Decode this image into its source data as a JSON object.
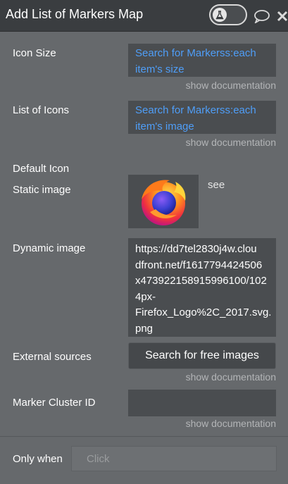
{
  "header": {
    "title": "Add List of Markers Map",
    "toggle_icon": "flask-icon",
    "chat_icon": "comment-icon",
    "close_icon": "close-icon"
  },
  "fields": {
    "icon_size": {
      "label": "Icon Size",
      "value_line1": "Search for Markerss:each",
      "value_line2": "item's size",
      "doc": "show documentation"
    },
    "list_of_icons": {
      "label": "List of Icons",
      "value_line1": "Search for Markerss:each",
      "value_line2": "item's image",
      "doc": "show documentation"
    },
    "default_icon": {
      "label": "Default Icon",
      "static_label": "Static image",
      "see_link": "see",
      "dynamic_label": "Dynamic image",
      "dynamic_lines": [
        "https://dd7tel2830j4w.clou",
        "dfront.net/f1617794424506",
        "x473922158915996100/102",
        "4px-",
        "Firefox_Logo%2C_2017.svg.",
        "png"
      ],
      "external_label": "External sources",
      "search_button": "Search for free images",
      "doc": "show documentation"
    },
    "marker_cluster": {
      "label": "Marker Cluster ID",
      "value": "",
      "doc": "show documentation"
    },
    "only_when": {
      "label": "Only when",
      "placeholder": "Click"
    }
  },
  "colors": {
    "panel_bg": "#66696c",
    "header_bg": "#3a3d40",
    "field_bg": "#4a4d50",
    "dynamic_text": "#4f9ef8",
    "muted_text": "#b3b5b7"
  }
}
